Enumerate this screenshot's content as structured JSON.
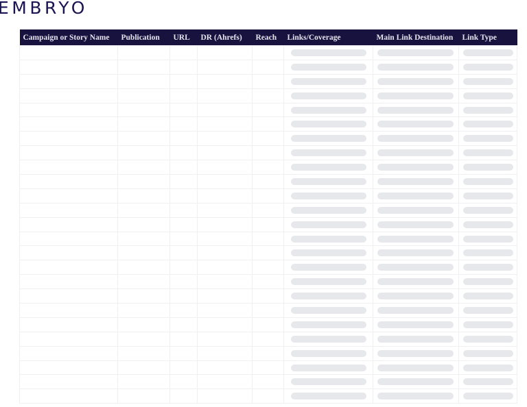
{
  "logo": {
    "text": "EMBRYO",
    "color": "#1b1452"
  },
  "table": {
    "header": {
      "background_color": "#18123f",
      "text_color": "#e7e4f0"
    },
    "columns": [
      {
        "key": "campaign",
        "label": "Campaign or Story Name",
        "placeholder": false
      },
      {
        "key": "publication",
        "label": "Publication",
        "placeholder": false
      },
      {
        "key": "url",
        "label": "URL",
        "placeholder": false
      },
      {
        "key": "dr",
        "label": "DR (Ahrefs)",
        "placeholder": false
      },
      {
        "key": "reach",
        "label": "Reach",
        "placeholder": false
      },
      {
        "key": "links",
        "label": "Links/Coverage",
        "placeholder": true
      },
      {
        "key": "destination",
        "label": "Main Link Destination",
        "placeholder": true
      },
      {
        "key": "linktype",
        "label": "Link Type",
        "placeholder": true
      }
    ],
    "body": {
      "row_count": 25,
      "cells_empty": true,
      "placeholder_pill_color": "#e7e8ec"
    }
  }
}
